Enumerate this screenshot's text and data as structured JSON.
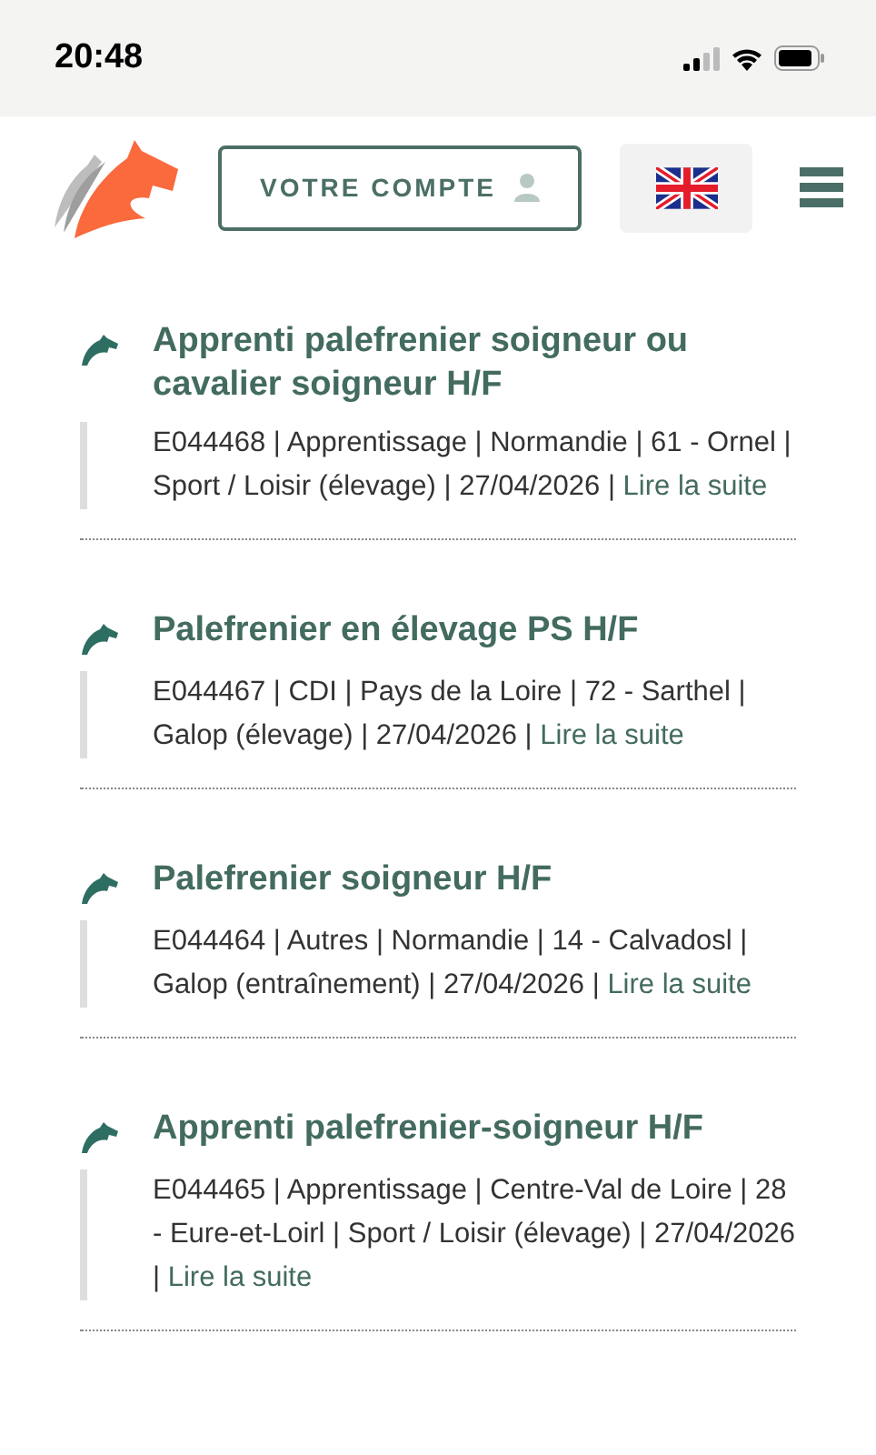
{
  "status_bar": {
    "time": "20:48"
  },
  "header": {
    "account_button": "VOTRE COMPTE"
  },
  "offers": [
    {
      "title": "Apprenti palefrenier soigneur ou cavalier soigneur H/F",
      "meta": "E044468 | Apprentissage | Normandie | 61 - Ornel | Sport / Loisir (élevage) | 27/04/2026 |",
      "link": "Lire la suite"
    },
    {
      "title": "Palefrenier en élevage PS H/F",
      "meta": "E044467 | CDI | Pays de la Loire | 72 - Sarthel | Galop (élevage) | 27/04/2026 |",
      "link": "Lire la suite"
    },
    {
      "title": "Palefrenier soigneur H/F",
      "meta": "E044464 | Autres | Normandie | 14 - Calvadosl | Galop (entraînement) | 27/04/2026 |",
      "link": "Lire la suite"
    },
    {
      "title": "Apprenti palefrenier-soigneur H/F",
      "meta": "E044465 | Apprentissage | Centre-Val de Loire | 28 - Eure-et-Loirl | Sport / Loisir (élevage) | 27/04/2026 |",
      "link": "Lire la suite"
    }
  ]
}
